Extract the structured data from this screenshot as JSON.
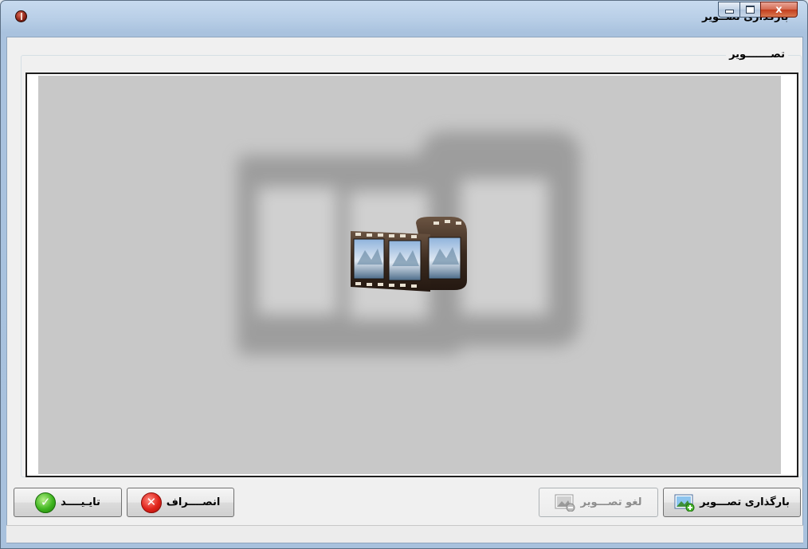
{
  "window": {
    "title": "بارگذاری تصــویر",
    "close_glyph": "x"
  },
  "group": {
    "title": "تصـــــــویر"
  },
  "buttons": {
    "load_image": "بارگذاری تصـــویر",
    "clear_image": "لغو تصـــویر",
    "cancel": "انصــــراف",
    "confirm": "تایـیــــد"
  },
  "colors": {
    "image_background": "#c8c8c8",
    "title_gradient": "#b9cfe7",
    "close_button": "#c23d1d"
  },
  "icons": {
    "app": "app-icon",
    "image_placeholder": "film-strip-icon",
    "load": "image-add-icon",
    "clear": "image-remove-icon",
    "cancel": "close-circle-icon",
    "confirm": "check-circle-icon"
  }
}
